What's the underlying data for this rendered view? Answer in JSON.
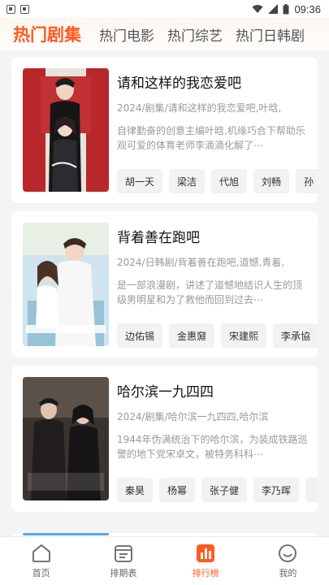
{
  "status_bar": {
    "time": "09:36"
  },
  "tabs": [
    {
      "label": "热门剧集",
      "active": true
    },
    {
      "label": "热门电影",
      "active": false
    },
    {
      "label": "热门综艺",
      "active": false
    },
    {
      "label": "热门日韩剧",
      "active": false
    }
  ],
  "shows": [
    {
      "title": "请和这样的我恋爱吧",
      "meta": "2024/剧集/请和这样的我恋爱吧,叶晗,",
      "desc": "自律勤奋的创意主编叶晗,机缘巧合下帮助乐观可爱的体育老师李滴滴化解了⋯",
      "cast": [
        "胡一天",
        "梁洁",
        "代旭",
        "刘畅",
        "孙"
      ]
    },
    {
      "title": "背着善在跑吧",
      "meta": "2024/日韩剧/背着善在跑吧,道憾,青着,",
      "desc": "是一部浪漫剧，讲述了道憾地结识人生的顶级男明星和为了救他而回到过去⋯",
      "cast": [
        "边佑锡",
        "金惠奫",
        "宋建熙",
        "李承協"
      ]
    },
    {
      "title": "哈尔滨一九四四",
      "meta": "2024/剧集/哈尔滨一九四四,哈尔滨",
      "desc": "1944年伪满统治下的哈尔滨，为装成铁路巡警的地下党宋卓文，被特务科科⋯",
      "cast": [
        "秦昊",
        "杨幂",
        "张子健",
        "李乃晖",
        ""
      ]
    }
  ],
  "tabbar": [
    {
      "label": "首页",
      "icon": "home-icon",
      "active": false
    },
    {
      "label": "排期表",
      "icon": "calendar-icon",
      "active": false
    },
    {
      "label": "排行榜",
      "icon": "chart-icon",
      "active": true
    },
    {
      "label": "我的",
      "icon": "smile-icon",
      "active": false
    }
  ],
  "colors": {
    "accent": "#ff5a1f",
    "background": "#f3f4f6"
  }
}
